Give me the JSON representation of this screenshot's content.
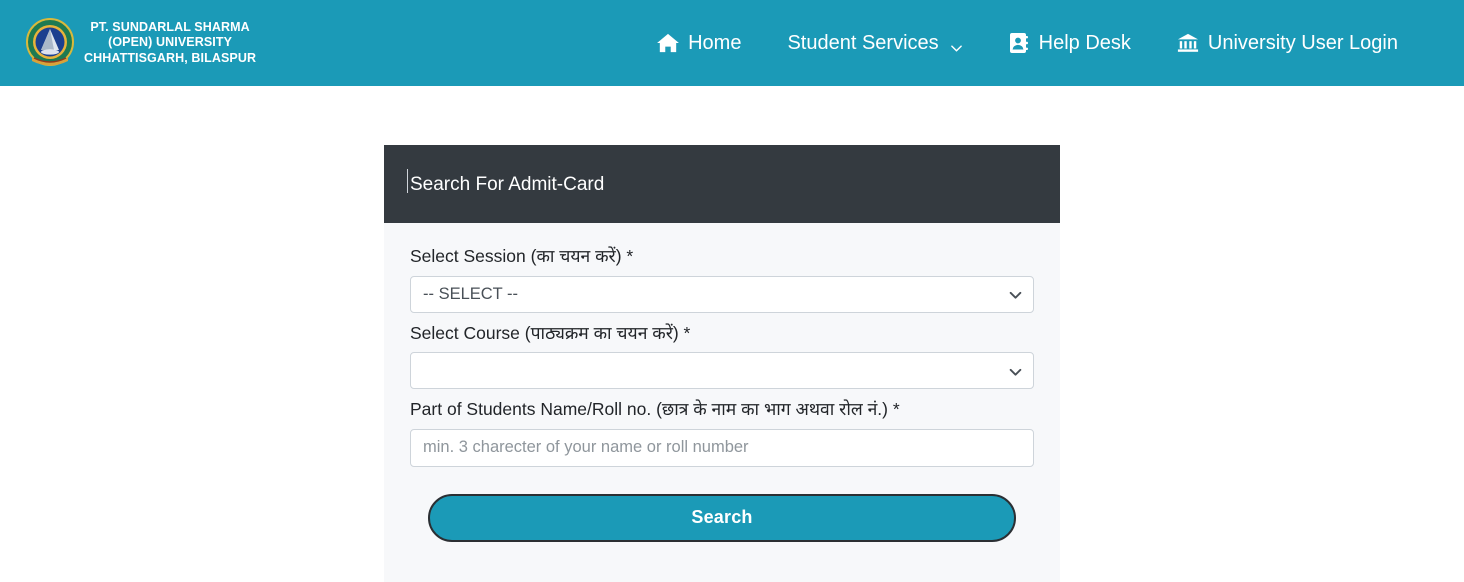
{
  "navbar": {
    "background_color": "#1b9ab7",
    "brand": {
      "logo_icon": "university-seal-logo",
      "line1": "PT. SUNDARLAL SHARMA",
      "line2": "(OPEN) UNIVERSITY",
      "line3": "CHHATTISGARH, BILASPUR"
    },
    "links": [
      {
        "label": "Home",
        "icon": "home-icon",
        "has_caret": false
      },
      {
        "label": "Student Services",
        "icon": null,
        "has_caret": true
      },
      {
        "label": "Help Desk",
        "icon": "address-book-icon",
        "has_caret": false
      },
      {
        "label": "University User Login",
        "icon": "university-building-icon",
        "has_caret": false
      }
    ]
  },
  "card": {
    "header": {
      "title": "Search For Admit-Card",
      "background_color": "#343a40"
    },
    "fields": [
      {
        "label": "Select Session (का चयन करें) *",
        "type": "select",
        "value": "-- SELECT --"
      },
      {
        "label": "Select Course (पाठ्यक्रम का चयन करें) *",
        "type": "select",
        "value": ""
      },
      {
        "label": "Part of Students Name/Roll no. (छात्र के नाम का भाग अथवा रोल नं.) *",
        "type": "text",
        "value": "",
        "placeholder": "min. 3 charecter of your name or roll number"
      }
    ],
    "submit_button": {
      "label": "Search",
      "color": "#1b9ab7"
    }
  }
}
